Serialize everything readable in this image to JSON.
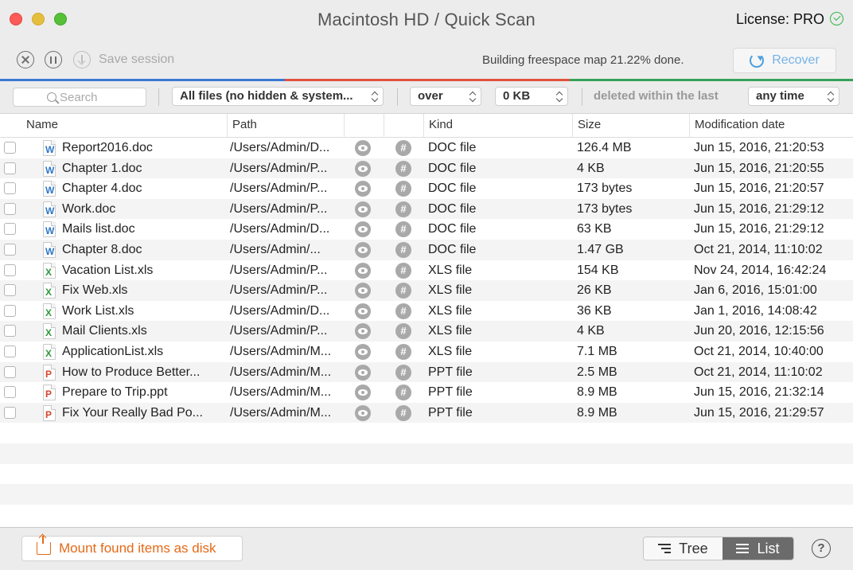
{
  "window": {
    "title": "Macintosh HD / Quick Scan",
    "license": "License: PRO"
  },
  "toolbar": {
    "save_label": "Save session",
    "status": "Building freespace map 21.22% done.",
    "recover_label": "Recover"
  },
  "progress_colors": [
    "#3a78d4",
    "#e2523d",
    "#e2523d",
    "#36a15a"
  ],
  "filters": {
    "search_placeholder": "Search",
    "file_type": "All files (no hidden & system...",
    "size_op": "over",
    "size_value": "0 KB",
    "deleted_label": "deleted within the last",
    "time_range": "any time"
  },
  "table": {
    "columns": [
      "Name",
      "Path",
      "",
      "",
      "Kind",
      "Size",
      "Modification date"
    ],
    "rows": [
      {
        "type": "doc",
        "letter": "W",
        "name": "Report2016.doc",
        "path": "/Users/Admin/D...",
        "kind": "DOC file",
        "size": "126.4 MB",
        "date": "Jun 15, 2016, 21:20:53"
      },
      {
        "type": "doc",
        "letter": "W",
        "name": "Chapter 1.doc",
        "path": "/Users/Admin/P...",
        "kind": "DOC file",
        "size": "4 KB",
        "date": "Jun 15, 2016, 21:20:55"
      },
      {
        "type": "doc",
        "letter": "W",
        "name": "Chapter 4.doc",
        "path": "/Users/Admin/P...",
        "kind": "DOC file",
        "size": "173 bytes",
        "date": "Jun 15, 2016, 21:20:57"
      },
      {
        "type": "doc",
        "letter": "W",
        "name": "Work.doc",
        "path": "/Users/Admin/P...",
        "kind": "DOC file",
        "size": "173 bytes",
        "date": "Jun 15, 2016, 21:29:12"
      },
      {
        "type": "doc",
        "letter": "W",
        "name": "Mails list.doc",
        "path": "/Users/Admin/D...",
        "kind": "DOC file",
        "size": "63 KB",
        "date": "Jun 15, 2016, 21:29:12"
      },
      {
        "type": "doc",
        "letter": "W",
        "name": "Chapter 8.doc",
        "path": "/Users/Admin/...",
        "kind": "DOC file",
        "size": "1.47 GB",
        "date": "Oct 21, 2014, 11:10:02"
      },
      {
        "type": "xls",
        "letter": "X",
        "name": "Vacation List.xls",
        "path": "/Users/Admin/P...",
        "kind": "XLS file",
        "size": "154 KB",
        "date": "Nov 24, 2014, 16:42:24"
      },
      {
        "type": "xls",
        "letter": "X",
        "name": "Fix Web.xls",
        "path": "/Users/Admin/P...",
        "kind": "XLS file",
        "size": "26 KB",
        "date": "Jan 6, 2016, 15:01:00"
      },
      {
        "type": "xls",
        "letter": "X",
        "name": "Work List.xls",
        "path": "/Users/Admin/D...",
        "kind": "XLS file",
        "size": "36 KB",
        "date": "Jan 1, 2016, 14:08:42"
      },
      {
        "type": "xls",
        "letter": "X",
        "name": "Mail Clients.xls",
        "path": "/Users/Admin/P...",
        "kind": "XLS file",
        "size": "4 KB",
        "date": "Jun 20, 2016, 12:15:56"
      },
      {
        "type": "xls",
        "letter": "X",
        "name": "ApplicationList.xls",
        "path": "/Users/Admin/M...",
        "kind": "XLS file",
        "size": "7.1 MB",
        "date": "Oct 21, 2014, 10:40:00"
      },
      {
        "type": "ppt",
        "letter": "P",
        "name": "How to Produce Better...",
        "path": "/Users/Admin/M...",
        "kind": "PPT file",
        "size": "2.5 MB",
        "date": "Oct 21, 2014, 11:10:02"
      },
      {
        "type": "ppt",
        "letter": "P",
        "name": "Prepare to Trip.ppt",
        "path": "/Users/Admin/M...",
        "kind": "PPT file",
        "size": "8.9 MB",
        "date": "Jun 15, 2016, 21:32:14"
      },
      {
        "type": "ppt",
        "letter": "P",
        "name": "Fix Your Really Bad Po...",
        "path": "/Users/Admin/M...",
        "kind": "PPT file",
        "size": "8.9 MB",
        "date": "Jun 15, 2016, 21:29:57"
      }
    ]
  },
  "bottom": {
    "mount_label": "Mount found items as disk",
    "tree_label": "Tree",
    "list_label": "List",
    "help_label": "?"
  }
}
